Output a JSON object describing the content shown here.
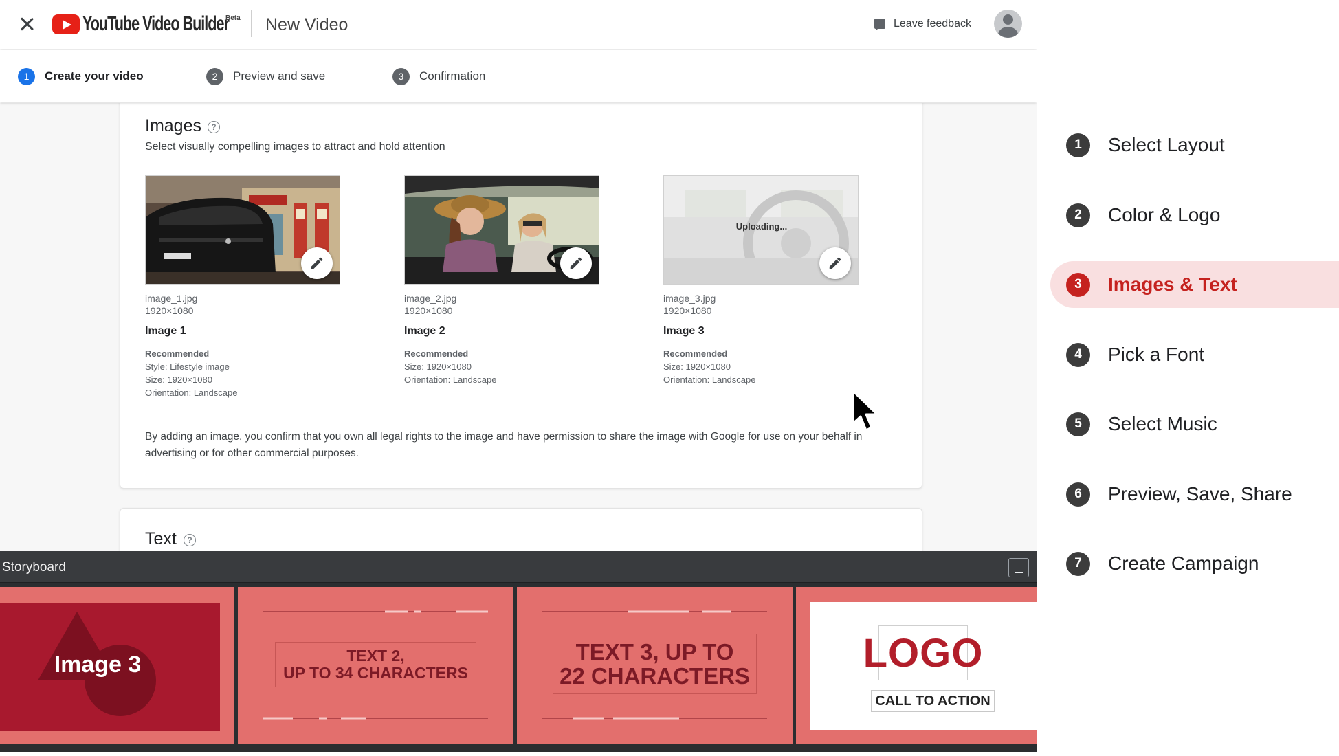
{
  "header": {
    "brand": "YouTube Video Builder",
    "beta": "Beta",
    "page_title": "New Video",
    "feedback": "Leave feedback"
  },
  "stepper": {
    "steps": [
      {
        "num": "1",
        "label": "Create your video",
        "active": true
      },
      {
        "num": "2",
        "label": "Preview and save",
        "active": false
      },
      {
        "num": "3",
        "label": "Confirmation",
        "active": false
      }
    ]
  },
  "images_section": {
    "title": "Images",
    "help": "?",
    "description": "Select visually compelling images to attract and hold attention",
    "items": [
      {
        "filename": "image_1.jpg",
        "dimensions": "1920×1080",
        "name": "Image 1",
        "rec_head": "Recommended",
        "rec_lines": [
          "Style: Lifestyle image",
          "Size: 1920×1080",
          "Orientation: Landscape"
        ]
      },
      {
        "filename": "image_2.jpg",
        "dimensions": "1920×1080",
        "name": "Image 2",
        "rec_head": "Recommended",
        "rec_lines": [
          "Size: 1920×1080",
          "Orientation: Landscape"
        ]
      },
      {
        "filename": "image_3.jpg",
        "dimensions": "1920×1080",
        "name": "Image 3",
        "uploading": "Uploading...",
        "rec_head": "Recommended",
        "rec_lines": [
          "Size: 1920×1080",
          "Orientation: Landscape"
        ]
      }
    ],
    "disclaimer": "By adding an image, you confirm that you own all legal rights to the image and have permission to share the image with Google for use on your behalf in advertising or for other commercial purposes."
  },
  "text_section": {
    "title": "Text",
    "help": "?"
  },
  "storyboard": {
    "title": "Storyboard",
    "frame1": "Image 3",
    "frame2_line1": "TEXT 2,",
    "frame2_line2": "UP TO 34 CHARACTERS",
    "frame3_line1": "TEXT 3, UP TO",
    "frame3_line2": "22 CHARACTERS",
    "frame4_logo": "LOGO",
    "frame4_cta": "CALL TO ACTION"
  },
  "side_steps": [
    {
      "num": "1",
      "label": "Select Layout",
      "active": false
    },
    {
      "num": "2",
      "label": "Color & Logo",
      "active": false
    },
    {
      "num": "3",
      "label": "Images & Text",
      "active": true
    },
    {
      "num": "4",
      "label": "Pick a Font",
      "active": false
    },
    {
      "num": "5",
      "label": "Select Music",
      "active": false
    },
    {
      "num": "6",
      "label": "Preview, Save, Share",
      "active": false
    },
    {
      "num": "7",
      "label": "Create Campaign",
      "active": false
    }
  ],
  "colors": {
    "accent_blue": "#1a73e8",
    "active_red": "#c5221f",
    "active_bg": "#f9dfe0",
    "storyboard_frame": "#e36f6d"
  }
}
